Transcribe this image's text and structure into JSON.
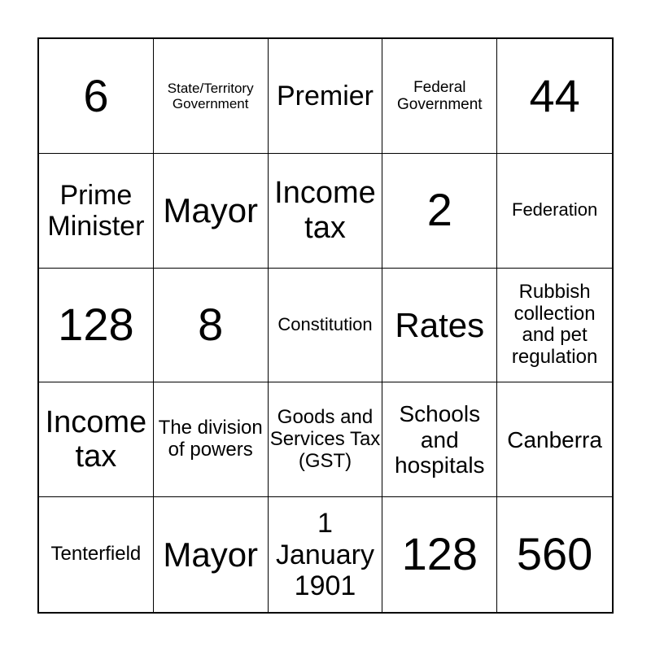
{
  "card": {
    "cells": [
      "6",
      "State/Territory Government",
      "Premier",
      "Federal Government",
      "44",
      "Prime Minister",
      "Mayor",
      "Income tax",
      "2",
      "Federation",
      "128",
      "8",
      "Constitution",
      "Rates",
      "Rubbish collection and pet regulation",
      "Income tax",
      "The division of powers",
      "Goods and Services Tax (GST)",
      "Schools and hospitals",
      "Canberra",
      "Tenterfield",
      "Mayor",
      "1 January 1901",
      "128",
      "560"
    ]
  }
}
